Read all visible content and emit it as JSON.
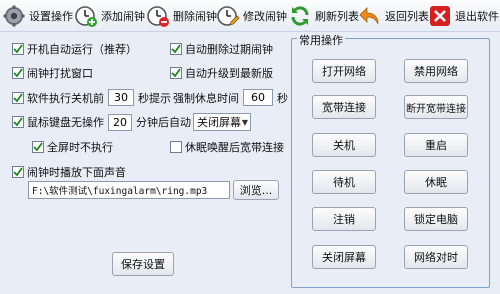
{
  "toolbar": {
    "settings": "设置操作",
    "add_alarm": "添加闹钟",
    "delete_alarm": "删除闹钟",
    "edit_alarm": "修改闹钟",
    "refresh_list": "刷新列表",
    "back_list": "返回列表",
    "exit": "退出软件"
  },
  "options": {
    "autostart": {
      "label": "开机自动运行（推荐）",
      "checked": true
    },
    "auto_delete_expired": {
      "label": "自动删除过期闹钟",
      "checked": true
    },
    "alarm_popup": {
      "label": "闹钟打扰窗口",
      "checked": true
    },
    "auto_upgrade": {
      "label": "自动升级到最新版",
      "checked": true
    },
    "shutdown_prompt": {
      "label_before": "软件执行关机前",
      "value": "30",
      "label_after": "秒提示",
      "checked": true
    },
    "forced_rest": {
      "label": "强制休息时间",
      "value": "60",
      "unit": "秒"
    },
    "idle_action": {
      "label_before": "鼠标键盘无操作",
      "value": "20",
      "label_after": "分钟后自动",
      "selected": "关闭屏幕",
      "checked": true
    },
    "fullscreen_skip": {
      "label": "全屏时不执行",
      "checked": true
    },
    "sleep_wake_disconnect": {
      "label": "休眠唤醒后宽带连接",
      "checked": false
    },
    "play_sound": {
      "label": "闹钟时播放下面声音",
      "checked": true
    },
    "sound_path": "F:\\软件测试\\fuxingalarm\\ring.mp3",
    "browse_label": "浏览...",
    "save_label": "保存设置"
  },
  "common_ops": {
    "title": "常用操作",
    "buttons": [
      "打开网络",
      "禁用网络",
      "宽带连接",
      "断开宽带连接",
      "关机",
      "重启",
      "待机",
      "休眠",
      "注销",
      "锁定电脑",
      "关闭屏幕",
      "网络对时"
    ]
  },
  "colors": {
    "background": "#e9eef6",
    "check": "#1a8a1a",
    "group_border": "#7fa3cf"
  }
}
